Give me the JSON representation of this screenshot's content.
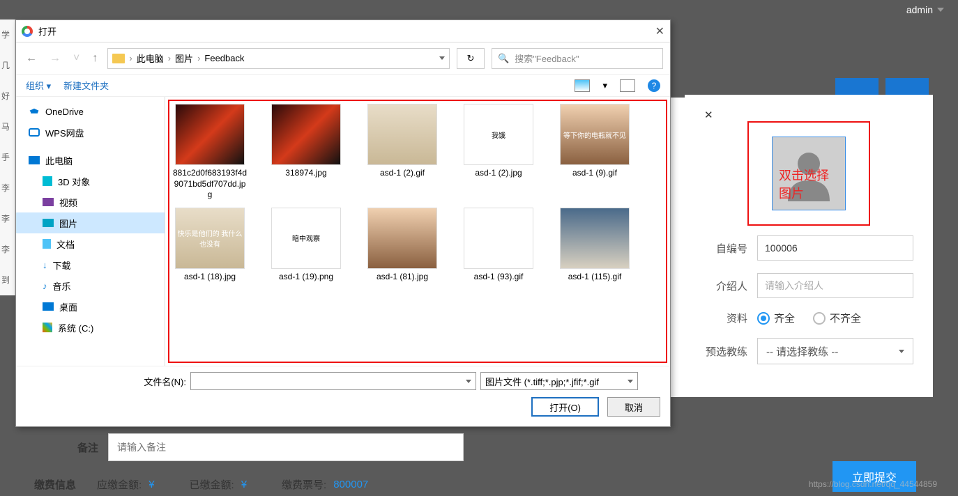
{
  "topbar": {
    "user": "admin"
  },
  "leftStrip": [
    "学",
    "几号",
    "好",
    "马蹊",
    "手",
    "李",
    "李",
    "李",
    "到"
  ],
  "dialog": {
    "title": "打开",
    "breadcrumb": [
      "此电脑",
      "图片",
      "Feedback"
    ],
    "searchPlaceholder": "搜索\"Feedback\"",
    "toolbar": {
      "org": "组织",
      "newFolder": "新建文件夹"
    },
    "tree": [
      {
        "label": "OneDrive",
        "icon": "ico-onedrive"
      },
      {
        "label": "WPS网盘",
        "icon": "ico-wps"
      },
      {
        "label": "此电脑",
        "icon": "ico-pc",
        "gap": true
      },
      {
        "label": "3D 对象",
        "icon": "ico-3d",
        "indent": true
      },
      {
        "label": "视频",
        "icon": "ico-video",
        "indent": true
      },
      {
        "label": "图片",
        "icon": "ico-pic",
        "indent": true,
        "active": true
      },
      {
        "label": "文档",
        "icon": "ico-doc",
        "indent": true
      },
      {
        "label": "下载",
        "icon": "ico-dl",
        "indent": true,
        "textIcon": "↓"
      },
      {
        "label": "音乐",
        "icon": "ico-music",
        "indent": true,
        "textIcon": "♪"
      },
      {
        "label": "桌面",
        "icon": "ico-desk",
        "indent": true
      },
      {
        "label": "系统 (C:)",
        "icon": "ico-sys",
        "indent": true
      }
    ],
    "files": [
      {
        "name": "881c2d0f683193f4d9071bd5df707dd.jpg",
        "thumb": "car"
      },
      {
        "name": "318974.jpg",
        "thumb": "car"
      },
      {
        "name": "asd-1 (2).gif",
        "thumb": "cat"
      },
      {
        "name": "asd-1 (2).jpg",
        "thumb": "meme",
        "memeText": "我饿"
      },
      {
        "name": "asd-1 (9).gif",
        "thumb": "person",
        "memeText": "等下你的电瓶就不见"
      },
      {
        "name": "asd-1 (18).jpg",
        "thumb": "cat",
        "memeText": "快乐是他们的 我什么也没有"
      },
      {
        "name": "asd-1 (19).png",
        "thumb": "panda",
        "memeText": "暗中观察"
      },
      {
        "name": "asd-1 (81).jpg",
        "thumb": "person"
      },
      {
        "name": "asd-1 (93).gif",
        "thumb": "meme"
      },
      {
        "name": "asd-1 (115).gif",
        "thumb": "goat"
      }
    ],
    "fileNameLabel": "文件名(N):",
    "filter": "图片文件 (*.tiff;*.pjp;*.jfif;*.gif",
    "openBtn": "打开(O)",
    "cancelBtn": "取消"
  },
  "form": {
    "photoOverlay": "双击选择图片",
    "idLabel": "自编号",
    "idValue": "100006",
    "introLabel": "介绍人",
    "introPlaceholder": "请输入介绍人",
    "matLabel": "资料",
    "matOpt1": "齐全",
    "matOpt2": "不齐全",
    "coachLabel": "预选教练",
    "coachPlaceholder": "-- 请选择教练 --",
    "remarkLabel": "备注",
    "remarkPlaceholder": "请输入备注"
  },
  "pay": {
    "title": "缴费信息",
    "due": "应缴金额:",
    "paid": "已缴金额:",
    "currency": "¥",
    "ticketLabel": "缴费票号:",
    "ticketNo": "800007"
  },
  "submit": "立即提交",
  "watermark": "https://blog.csdn.net/qq_44544859"
}
